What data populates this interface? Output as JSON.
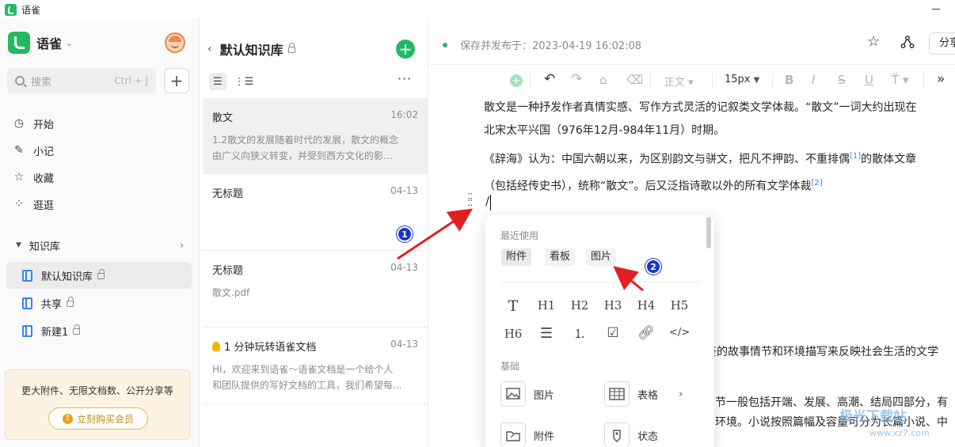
{
  "titlebar": {
    "title": "语雀",
    "minimize": "—"
  },
  "sidebar": {
    "brand": "语雀",
    "search_placeholder": "搜索",
    "search_shortcut": "Ctrl + J",
    "nav": [
      {
        "label": "开始",
        "icon": "clock-icon"
      },
      {
        "label": "小记",
        "icon": "feather-icon"
      },
      {
        "label": "收藏",
        "icon": "star-icon"
      },
      {
        "label": "逛逛",
        "icon": "grid-icon"
      }
    ],
    "kb_header": "知识库",
    "knowledge_bases": [
      {
        "label": "默认知识库",
        "locked": true
      },
      {
        "label": "共享",
        "locked": true
      },
      {
        "label": "新建1",
        "locked": true
      }
    ],
    "promo_text": "更大附件、无限文档数、公开分享等",
    "promo_button": "立刻购买会员"
  },
  "doclist": {
    "title": "默认知识库",
    "docs": [
      {
        "title": "散文",
        "time": "16:02",
        "preview": [
          "1.2散文的发展随着时代的发展，散文的概念",
          "由广义向狭义转变，并受到西方文化的影..."
        ]
      },
      {
        "title": "无标题",
        "time": "04-13",
        "preview": []
      },
      {
        "title": "无标题",
        "time": "04-13",
        "preview": [
          "散文.pdf"
        ]
      },
      {
        "title": "1 分钟玩转语雀文档",
        "time": "04-13",
        "preview": [
          "Hi，欢迎来到语雀～语雀文档是一个给个人",
          "和团队提供的写好文档的工具，我们希望每..."
        ]
      }
    ]
  },
  "editor": {
    "saved_status": "保存并发布于：2023-04-19 16:02:08",
    "share_label": "分享",
    "toolbar": {
      "style": "正文",
      "font_size": "15px"
    },
    "paragraphs": [
      "散文是一种抒发作者真情实感、写作方式灵活的记叙类文学体裁。“散文”一词大约出现在",
      "北宋太平兴国（976年12月-984年11月）时期。",
      "《辞海》认为：中国六朝以来，为区别韵文与骈文，把凡不押韵、不重排偶",
      "的散体文章",
      "（包括经传史书），统称“散文”。后又泛指诗歌以外的所有文学体裁"
    ],
    "refs": [
      "[1]",
      "[2]"
    ],
    "slash": "/",
    "bg_fragments": [
      "鉴的故事情节和环境描写来反映社会生活的文学",
      "节一般包括开端、发展、高潮、结局四部分，有",
      "环境。小说按照篇幅及容量可分为长篇小说、中"
    ]
  },
  "slash_menu": {
    "recent_label": "最近使用",
    "recent": [
      "附件",
      "看板",
      "图片"
    ],
    "formats": [
      "T",
      "H1",
      "H2",
      "H3",
      "H4",
      "H5",
      "H6",
      "bullet-list-icon",
      "ordered-list-icon",
      "checkbox-icon",
      "link-icon",
      "code-icon"
    ],
    "basic_label": "基础",
    "blocks": [
      {
        "label": "图片",
        "icon": "image-icon"
      },
      {
        "label": "表格",
        "icon": "table-icon"
      },
      {
        "label": "附件",
        "icon": "attachment-icon"
      },
      {
        "label": "状态",
        "icon": "status-icon"
      }
    ]
  },
  "annotations": {
    "badge1": "1",
    "badge2": "2"
  },
  "watermark": {
    "text": "极光下载站",
    "url": "www.xz7.com"
  },
  "colors": {
    "brand_green": "#25b864",
    "link_blue": "#3b82f6",
    "arrow_red": "#e02020",
    "badge_blue": "#1a37c9"
  }
}
